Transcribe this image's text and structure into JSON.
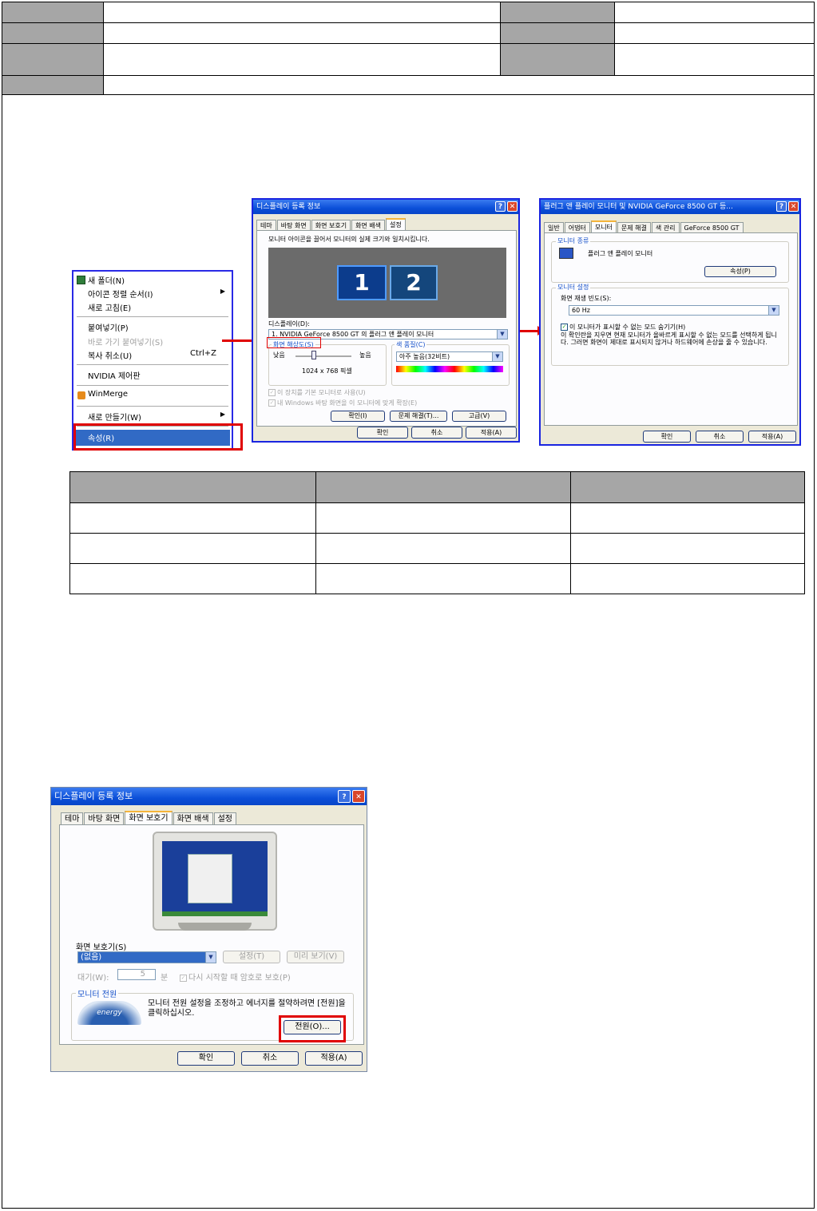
{
  "header_rows": [
    [
      "",
      ""
    ],
    [
      "",
      ""
    ],
    [
      "",
      ""
    ]
  ],
  "dialog1": {
    "title": "디스플레이 등록 정보",
    "tabs": [
      "테마",
      "바탕 화면",
      "화면 보호기",
      "화면 배색",
      "설정"
    ],
    "instruction": "모니터 아이콘을 끌어서 모니터의 실제 크기와 일치시킵니다.",
    "monitor1": "1",
    "monitor2": "2",
    "display_label": "디스플레이(D):",
    "display_value": "1. NVIDIA GeForce 8500 GT 의 플러그 앤 플레이 모니터",
    "resolution_label": "화면 해상도(S)",
    "low": "낮음",
    "high": "높음",
    "resolution_value": "1024 x 768 픽셀",
    "color_label": "색 품질(C)",
    "color_value": "아주 높음(32비트)",
    "check1": "이 장치를 기본 모니터로 사용(U)",
    "check2": "내 Windows 바탕 화면을 이 모니터에 맞게 확장(E)",
    "identify_button": "확인(I)",
    "troubleshoot_button": "문제 해결(T)...",
    "advanced_button": "고급(V)",
    "ok": "확인",
    "cancel": "취소",
    "apply": "적용(A)"
  },
  "context_menu": {
    "items": [
      "새 폴더(N)",
      "아이콘 정렬 순서(I)",
      "새로 고침(E)",
      "붙여넣기(P)",
      "바로 가기 붙여넣기(S)",
      "복사 취소(U)",
      "NVIDIA 제어판",
      "WinMerge",
      "새로 만들기(W)",
      "속성(R)"
    ],
    "shortcut": "Ctrl+Z"
  },
  "dialog2": {
    "title": "플러그 앤 플레이 모니터 및 NVIDIA GeForce 8500 GT 등...",
    "tabs": [
      "일반",
      "어댑터",
      "모니터",
      "문제 해결",
      "색 관리",
      "GeForce 8500 GT"
    ],
    "monitor_type_label": "모니터 종류",
    "monitor_type_value": "플러그 앤 플레이 모니터",
    "properties_button": "속성(P)",
    "monitor_settings_label": "모니터 설정",
    "refresh_label": "화면 재생 빈도(S):",
    "refresh_value": "60 Hz",
    "hide_modes": "이 모니터가 표시할 수 없는 모드 숨기기(H)",
    "warning": "이 확인란을 지우면 현재 모니터가 올바르게 표시할 수 없는 모드를 선택하게 됩니다. 그러면 화면이 제대로 표시되지 않거나 하드웨어에 손상을 줄 수 있습니다.",
    "ok": "확인",
    "cancel": "취소",
    "apply": "적용(A)"
  },
  "table_rows": [
    [
      "",
      "",
      ""
    ],
    [
      "",
      "",
      ""
    ],
    [
      "",
      "",
      ""
    ],
    [
      "",
      "",
      ""
    ]
  ],
  "dialog3": {
    "title": "디스플레이 등록 정보",
    "tabs": [
      "테마",
      "바탕 화면",
      "화면 보호기",
      "화면 배색",
      "설정"
    ],
    "screensaver_label": "화면 보호기(S)",
    "screensaver_value": "(없음)",
    "settings_button": "설정(T)",
    "preview_button": "미리 보기(V)",
    "wait_label": "대기(W):",
    "wait_value": "5",
    "wait_unit": "분",
    "resume_check": "다시 시작할 때 암호로 보호(P)",
    "power_label": "모니터 전원",
    "power_text": "모니터 전원 설정을 조정하고 에너지를 절약하려면 [전원]을 클릭하십시오.",
    "power_button": "전원(O)...",
    "energy_logo": "energy",
    "ok": "확인",
    "cancel": "취소",
    "apply": "적용(A)"
  },
  "colors": {
    "highlight": "#e00000",
    "frame": "#1a25e0",
    "header_gray": "#a6a6a6"
  }
}
